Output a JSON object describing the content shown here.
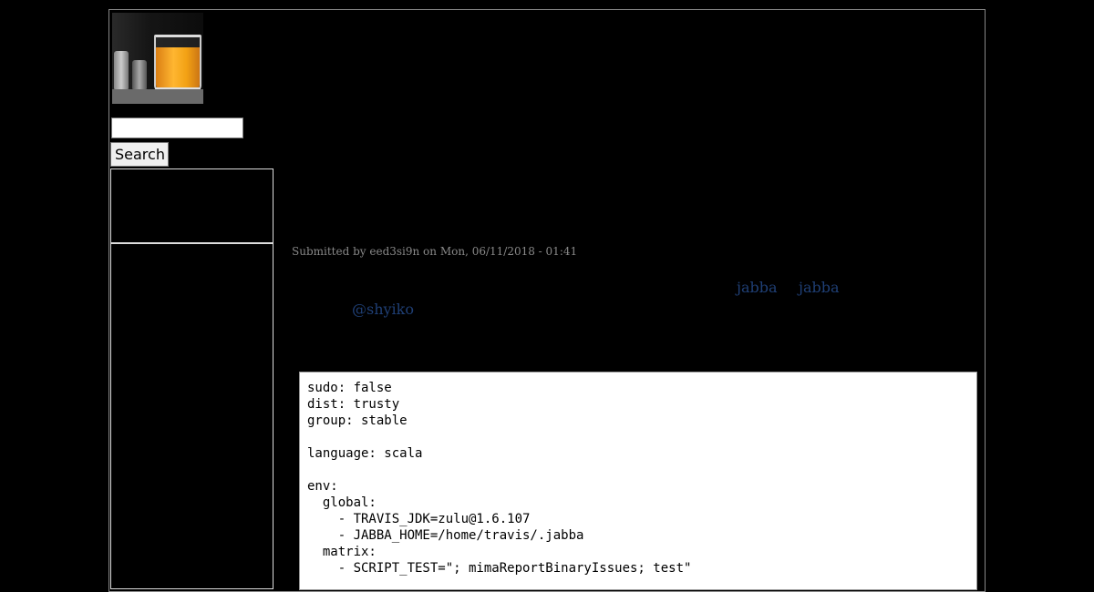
{
  "header": {
    "logo_icon": "orange-juice-glass-logo"
  },
  "search": {
    "value": "",
    "placeholder": "",
    "button_label": "Search"
  },
  "article": {
    "submitted": "Submitted by eed3si9n on Mon, 06/11/2018 - 01:41",
    "links": {
      "jabba_1": "jabba",
      "jabba_2": "jabba",
      "mention": "@shyiko"
    },
    "code_lines": [
      "sudo: false",
      "dist: trusty",
      "group: stable",
      "",
      "language: scala",
      "",
      "env:",
      "  global:",
      "    - TRAVIS_JDK=zulu@1.6.107",
      "    - JABBA_HOME=/home/travis/.jabba",
      "  matrix:",
      "    - SCRIPT_TEST=\"; mimaReportBinaryIssues; test\""
    ]
  },
  "colors": {
    "background": "#000000",
    "link": "#1f3f75",
    "meta_text": "#888888"
  }
}
